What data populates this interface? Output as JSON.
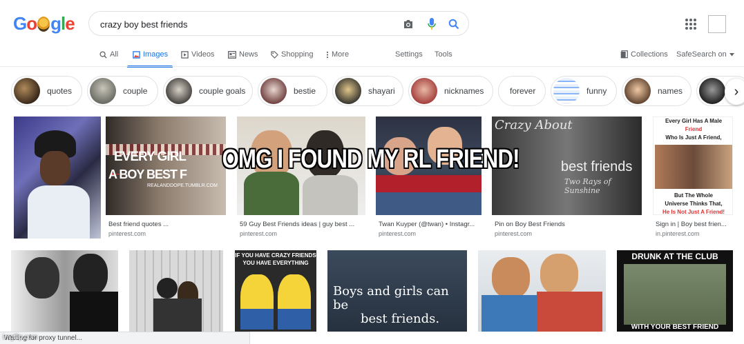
{
  "logo": {
    "letters": [
      "G",
      "o",
      "",
      "g",
      "l",
      "e"
    ]
  },
  "search": {
    "query": "crazy boy best friends"
  },
  "nav": {
    "tabs": [
      {
        "label": "All",
        "icon": "search-icon"
      },
      {
        "label": "Images",
        "icon": "image-icon"
      },
      {
        "label": "Videos",
        "icon": "play-icon"
      },
      {
        "label": "News",
        "icon": "news-icon"
      },
      {
        "label": "Shopping",
        "icon": "tag-icon"
      },
      {
        "label": "More",
        "icon": "more-vert-icon"
      }
    ],
    "settings": "Settings",
    "tools": "Tools",
    "collections": "Collections",
    "safesearch": "SafeSearch on"
  },
  "chips": [
    {
      "label": "quotes"
    },
    {
      "label": "couple"
    },
    {
      "label": "couple goals"
    },
    {
      "label": "bestie"
    },
    {
      "label": "shayari"
    },
    {
      "label": "nicknames"
    },
    {
      "label": "forever"
    },
    {
      "label": "funny"
    },
    {
      "label": "names"
    }
  ],
  "row1": [
    {
      "caption": "",
      "source": "",
      "text_lines": []
    },
    {
      "caption": "Best friend quotes ...",
      "source": "pinterest.com",
      "text_lines": [
        "EVERY GIRL",
        "A BOY BEST F",
        "REALANDDOPE.TUMBLR.COM"
      ]
    },
    {
      "caption": "59 Guy Best Friends ideas | guy best ...",
      "source": "pinterest.com",
      "text_lines": []
    },
    {
      "caption": "Twan Kuyper (@twan) • Instagr...",
      "source": "pinterest.com",
      "text_lines": []
    },
    {
      "caption": "Pin on Boy Best Friends",
      "source": "pinterest.com",
      "text_lines": [
        "Crazy About",
        "best friends",
        "Two Rays of Sunshine"
      ]
    },
    {
      "caption": "Sign in | Boy best frien...",
      "source": "in.pinterest.com",
      "text_lines": [
        "Every Girl Has A Male",
        "Friend",
        "Who Is Just A Friend,",
        "But The Whole",
        "Universe Thinks That,",
        "He Is Not Just A Friend!"
      ]
    }
  ],
  "row2": [
    {
      "text_lines": []
    },
    {
      "text_lines": []
    },
    {
      "text_lines": [
        "IF YOU HAVE CRAZY FRIENDS",
        "YOU HAVE EVERYTHING"
      ]
    },
    {
      "text_lines": [
        "Boys and girls can be",
        "best friends."
      ]
    },
    {
      "text_lines": []
    },
    {
      "text_lines": [
        "DRUNK AT THE CLUB",
        "WITH YOUR BEST FRIEND"
      ]
    }
  ],
  "overlay": "OMG I FOUND MY RL FRIEND!",
  "status_bar": "Waiting for proxy tunnel...",
  "watermark": "imgflip.com",
  "colors": {
    "accent": "#1a73e8",
    "text_secondary": "#5f6368"
  }
}
